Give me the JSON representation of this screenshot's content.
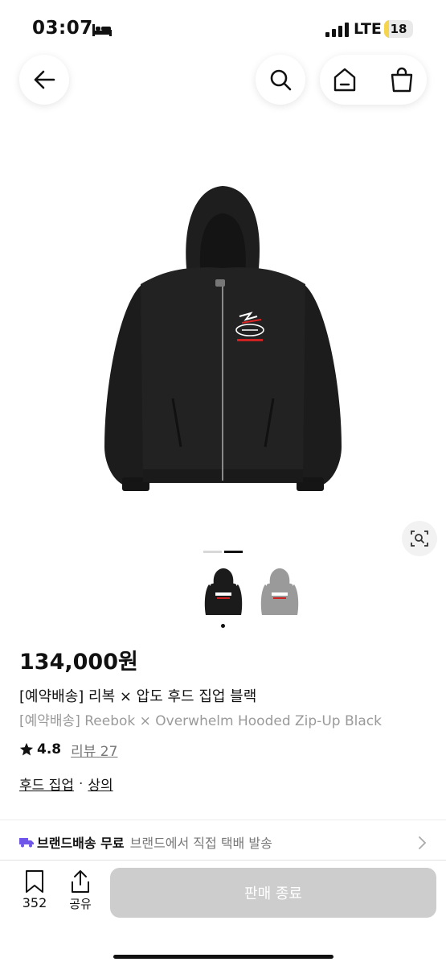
{
  "status": {
    "time": "03:07",
    "network": "LTE",
    "battery": "18",
    "battery_level": 0.18
  },
  "nav": {
    "back_icon": "arrow-left-icon",
    "search_icon": "search-icon",
    "home_icon": "home-icon",
    "cart_icon": "shopping-bag-icon"
  },
  "product": {
    "price": "134,000원",
    "title_ko": "[예약배송] 리복 × 압도 후드 집업 블랙",
    "title_en": "[예약배송] Reebok × Overwhelm Hooded Zip-Up Black",
    "rating": "4.8",
    "review": "리뷰 27",
    "category_1": "후드 집업",
    "category_sep": "·",
    "category_2": "상의",
    "image_count": 2,
    "image_index": 2,
    "thumbnails": [
      {
        "color": "#1b1b1b",
        "label": "Reebok"
      },
      {
        "color": "#9a9a9a",
        "label": "Reebok"
      }
    ]
  },
  "delivery": {
    "label": "브랜드배송 무료",
    "detail": "브랜드에서 직접 택배 발송"
  },
  "bottom": {
    "wishlist_count": "352",
    "share_label": "공유",
    "buy_label": "판매 종료"
  },
  "colors": {
    "disabled_button": "#cdcdcd",
    "delivery_icon": "#6f55e8",
    "battery_fill": "#f5d44e"
  }
}
